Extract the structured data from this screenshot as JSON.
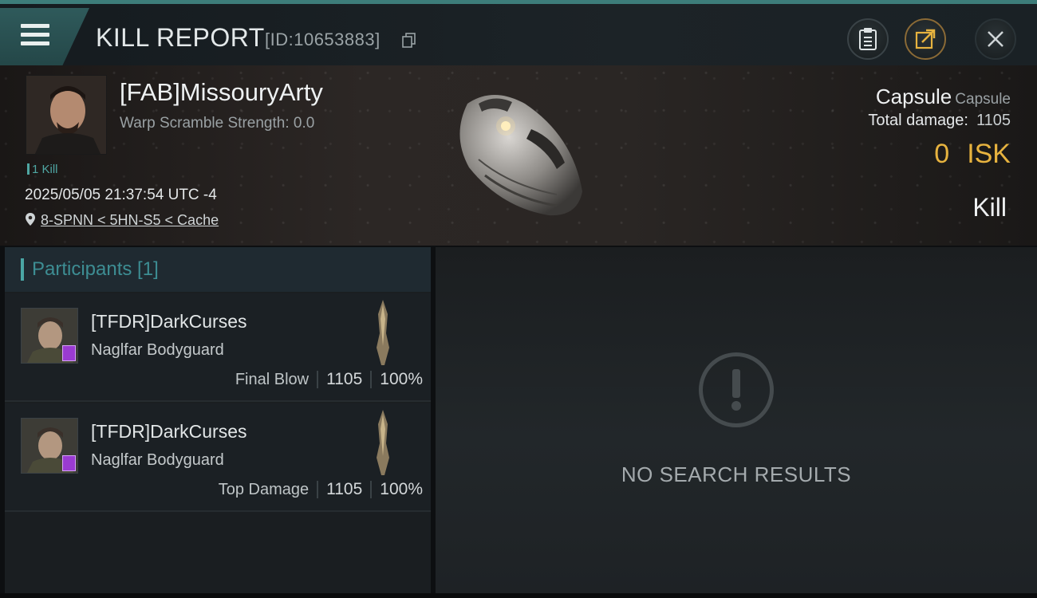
{
  "header": {
    "title": "KILL REPORT",
    "kill_id": "[ID:10653883]"
  },
  "victim": {
    "name": "[FAB]MissouryArty",
    "warp_scramble": "Warp Scramble Strength: 0.0",
    "kill_count": "1 Kill",
    "datetime": "2025/05/05 21:37:54 UTC -4",
    "location": "8-SPNN < 5HN-S5 < Cache",
    "ship_type": "Capsule",
    "ship_class": "Capsule",
    "total_damage_label": "Total damage:",
    "total_damage_value": "1105",
    "isk_value": "0",
    "isk_unit": "ISK",
    "result": "Kill"
  },
  "participants": {
    "header": "Participants [1]",
    "rows": [
      {
        "name": "[TFDR]DarkCurses",
        "ship": "Naglfar Bodyguard",
        "label": "Final Blow",
        "damage": "1105",
        "percent": "100%"
      },
      {
        "name": "[TFDR]DarkCurses",
        "ship": "Naglfar Bodyguard",
        "label": "Top Damage",
        "damage": "1105",
        "percent": "100%"
      }
    ]
  },
  "results": {
    "empty_text": "NO SEARCH RESULTS"
  },
  "icons": {
    "menu": "menu-icon",
    "copy": "copy-icon",
    "clipboard": "clipboard-icon",
    "share": "share-icon",
    "close": "close-icon",
    "location": "location-pin-icon",
    "empty": "exclamation-icon"
  },
  "colors": {
    "accent_teal": "#4aa6a5",
    "isk_gold": "#e7b33f",
    "badge_purple": "#9a3bd1"
  }
}
